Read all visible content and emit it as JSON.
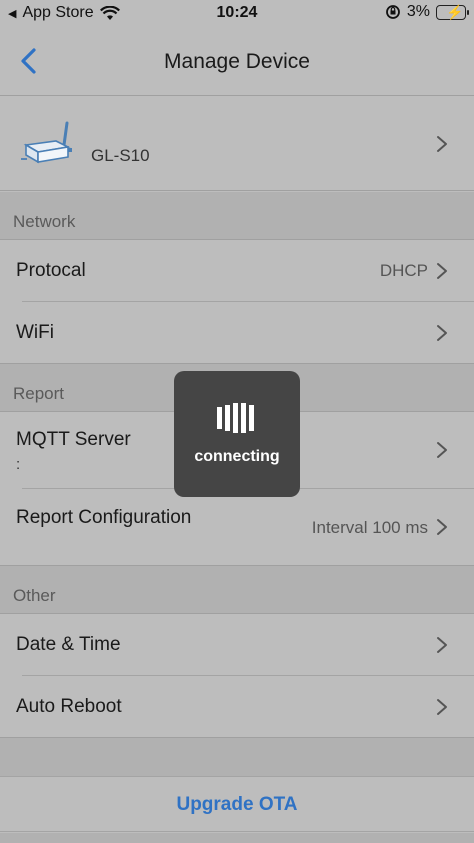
{
  "status_bar": {
    "carrier": "App Store",
    "time": "10:24",
    "battery": "3%"
  },
  "nav": {
    "title": "Manage Device"
  },
  "device": {
    "name": "GL-S10"
  },
  "sections": {
    "network": {
      "header": "Network",
      "protocal": {
        "label": "Protocal",
        "value": "DHCP"
      },
      "wifi": {
        "label": "WiFi"
      }
    },
    "report": {
      "header": "Report",
      "mqtt": {
        "label": "MQTT Server",
        "sub": ":"
      },
      "report_config": {
        "label": "Report Configuration",
        "value": "Interval 100 ms"
      }
    },
    "other": {
      "header": "Other",
      "date_time": {
        "label": "Date & Time"
      },
      "auto_reboot": {
        "label": "Auto Reboot"
      }
    }
  },
  "ota": {
    "label": "Upgrade OTA"
  },
  "hud": {
    "text": "connecting"
  },
  "colors": {
    "accent": "#2f72c4",
    "background": "#bdbdbd",
    "section_bg": "#b1b1b1",
    "hud_bg": "#454545"
  }
}
